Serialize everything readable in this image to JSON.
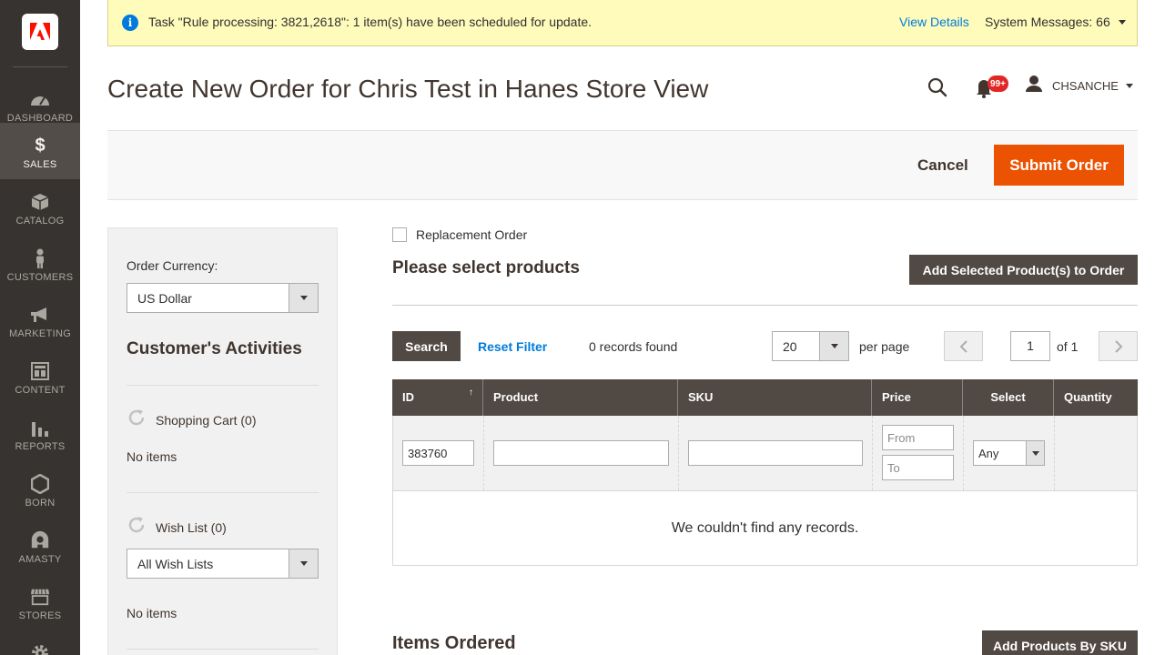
{
  "sidebar": {
    "logo": "adobe-logo-icon",
    "items": [
      {
        "label": "DASHBOARD",
        "icon": "dashboard-icon"
      },
      {
        "label": "SALES",
        "icon": "dollar-icon"
      },
      {
        "label": "CATALOG",
        "icon": "catalog-box-icon"
      },
      {
        "label": "CUSTOMERS",
        "icon": "customer-person-icon"
      },
      {
        "label": "MARKETING",
        "icon": "megaphone-icon"
      },
      {
        "label": "CONTENT",
        "icon": "content-layout-icon"
      },
      {
        "label": "REPORTS",
        "icon": "bar-chart-icon"
      },
      {
        "label": "BORN",
        "icon": "hexagon-icon"
      },
      {
        "label": "AMASTY",
        "icon": "amasty-icon"
      },
      {
        "label": "STORES",
        "icon": "store-icon"
      }
    ],
    "active_item": "SALES"
  },
  "system_message": {
    "text": "Task \"Rule processing: 3821,2618\": 1 item(s) have been scheduled for update.",
    "view_details": "View Details",
    "messages_count": "System Messages: 66"
  },
  "header": {
    "title": "Create New Order for Chris Test in Hanes Store View",
    "notifications_badge": "99+",
    "user_name": "CHSANCHE"
  },
  "actions": {
    "cancel": "Cancel",
    "submit": "Submit Order"
  },
  "left_panel": {
    "currency_label": "Order Currency:",
    "currency_value": "US Dollar",
    "activities_heading": "Customer's Activities",
    "shopping_cart": "Shopping Cart (0)",
    "shopping_cart_empty": "No items",
    "wish_list": "Wish List (0)",
    "wish_list_select": "All Wish Lists",
    "wish_list_empty": "No items"
  },
  "main": {
    "replacement_order": "Replacement Order",
    "products_title": "Please select products",
    "add_selected_button": "Add Selected Product(s) to Order",
    "search_button": "Search",
    "reset_filter": "Reset Filter",
    "records_found": "0 records found",
    "per_page_value": "20",
    "per_page_label": "per page",
    "page_current": "1",
    "page_of": "of 1",
    "grid": {
      "columns": [
        "ID",
        "Product",
        "SKU",
        "Price",
        "Select",
        "Quantity"
      ],
      "sort_indicator": "↑",
      "filter_id_value": "383760",
      "filter_price_from": "From",
      "filter_price_to": "To",
      "filter_select_value": "Any",
      "empty_message": "We couldn't find any records."
    },
    "items_ordered_title": "Items Ordered",
    "add_by_sku_button": "Add Products By SKU"
  },
  "colors": {
    "sidebar_bg": "#373330",
    "sidebar_active": "#524d49",
    "primary_button": "#eb5202",
    "dark_button": "#514943",
    "link": "#007bdb",
    "system_message_bg": "#fffbbb"
  }
}
